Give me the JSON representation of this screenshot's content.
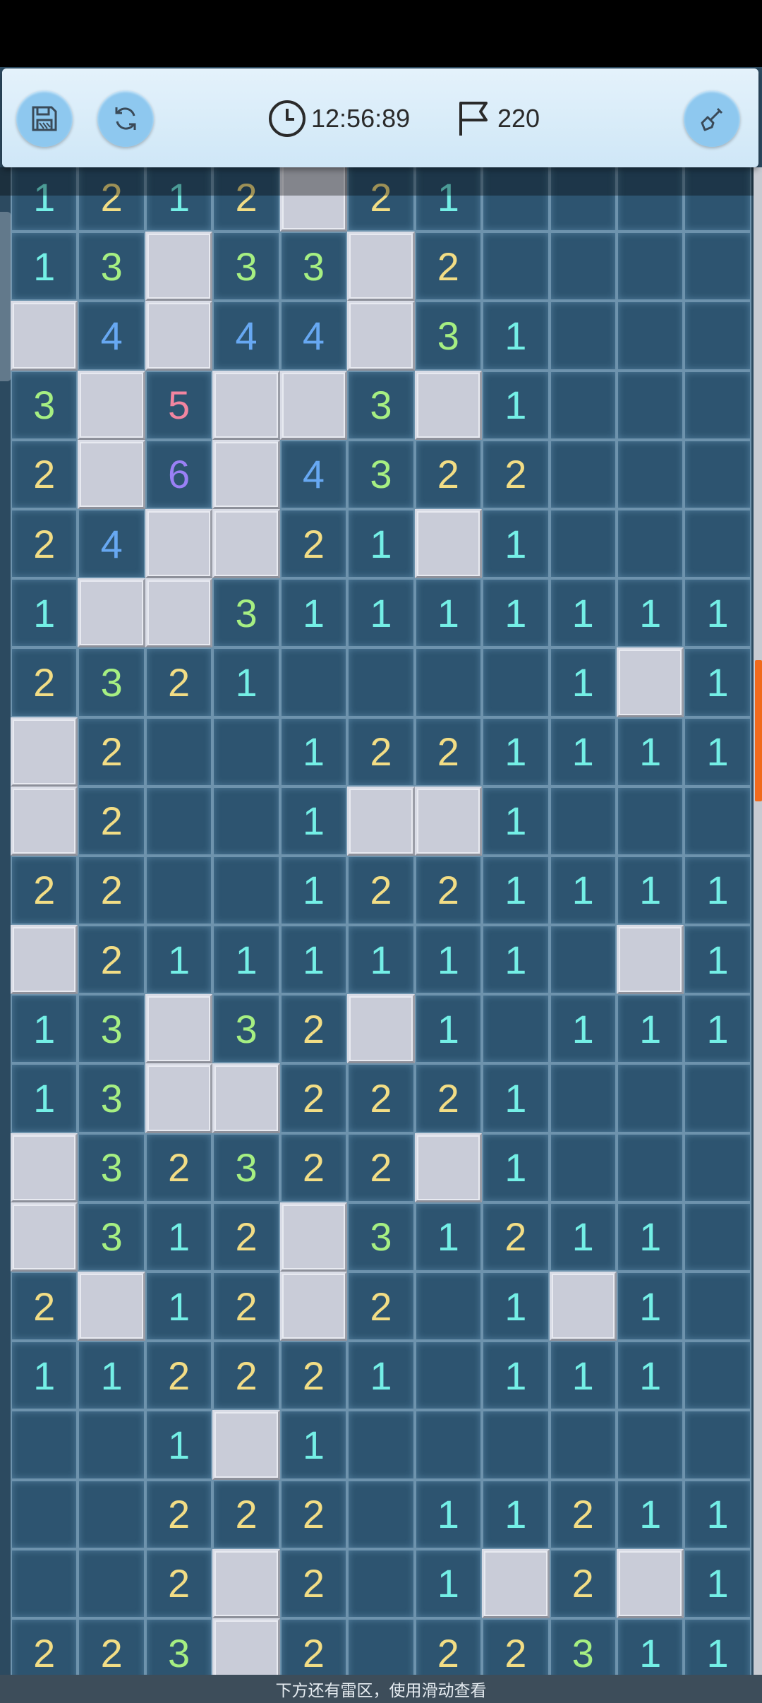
{
  "toolbar": {
    "timer": "12:56:89",
    "flags": "220",
    "icons": [
      "save-icon",
      "refresh-icon",
      "clock-icon",
      "flag-icon",
      "shovel-icon"
    ]
  },
  "hint": "下方还有雷区，使用滑动查看",
  "colors": {
    "revealed": "#2d5470",
    "covered": "#c9ccd8",
    "n1": "#74efe6",
    "n2": "#f2dd85",
    "n3": "#a6ef82",
    "n4": "#67a8f2",
    "n5": "#f285a0",
    "n6": "#9a80f5",
    "scroll_thumb": "#f06a1c"
  },
  "board": {
    "columns": 11,
    "legend": "'#' = covered tile, '.' = empty revealed tile, digit = revealed count",
    "rows": [
      "1212#21....",
      "13#33#2....",
      "#4#44#31...",
      "3#5##3#1...",
      "2#6#4322...",
      "24##21#1...",
      "1##31111111",
      "2321....1#1",
      "#2..1221111",
      "#2..1##1...",
      "22..1221111",
      "#2111111.#1",
      "13#32#1.111",
      "13##2221...",
      "#32322#1...",
      "#312#31211.",
      "2#12#2.1#1.",
      "112221.111.",
      "..1#1......",
      "..222.11211",
      "..2#2.1#2#1",
      "223#2.22311"
    ]
  }
}
